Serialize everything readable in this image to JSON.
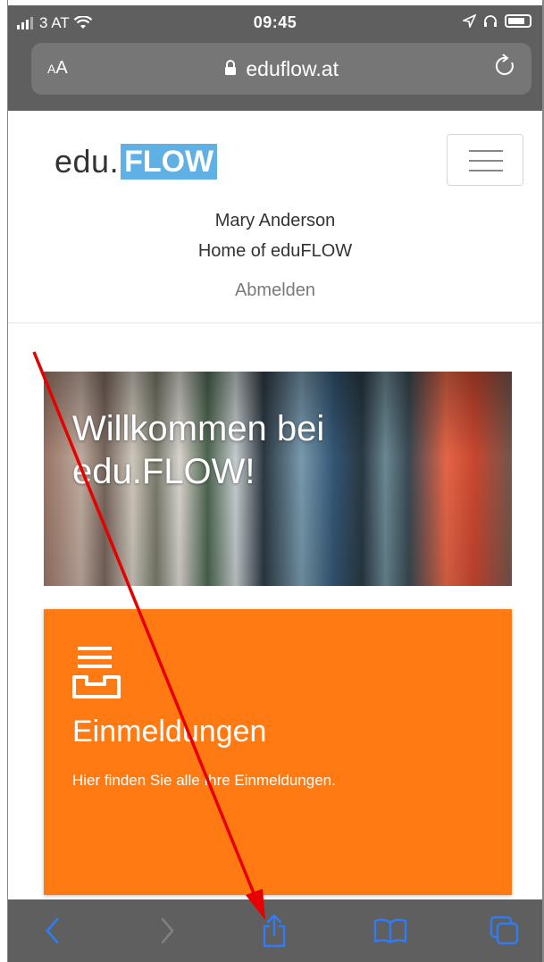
{
  "status_bar": {
    "carrier": "3 AT",
    "time": "09:45"
  },
  "browser": {
    "text_size_small": "A",
    "text_size_large": "A",
    "domain": "eduflow.at",
    "icons": [
      "lock-icon",
      "reload-icon",
      "back-icon",
      "forward-icon",
      "share-icon",
      "bookmarks-icon",
      "tabs-icon",
      "wifi-icon",
      "location-icon",
      "headphones-icon",
      "battery-icon"
    ]
  },
  "header": {
    "logo_text": "edu.",
    "logo_box": "FLOW",
    "user_name": "Mary Anderson",
    "subtitle": "Home of eduFLOW",
    "logout_label": "Abmelden"
  },
  "hero": {
    "title": "Willkommen bei edu.FLOW!"
  },
  "card": {
    "title": "Einmeldungen",
    "description": "Hier finden Sie alle Ihre Einmeldungen.",
    "icon": "inbox-icon",
    "color": "#ff7a12"
  },
  "colors": {
    "browser_chrome": "#5f5f5f",
    "ios_blue": "#2f7cf6",
    "logo_blue": "#5fb0e4",
    "annotation_red": "#e60000"
  }
}
